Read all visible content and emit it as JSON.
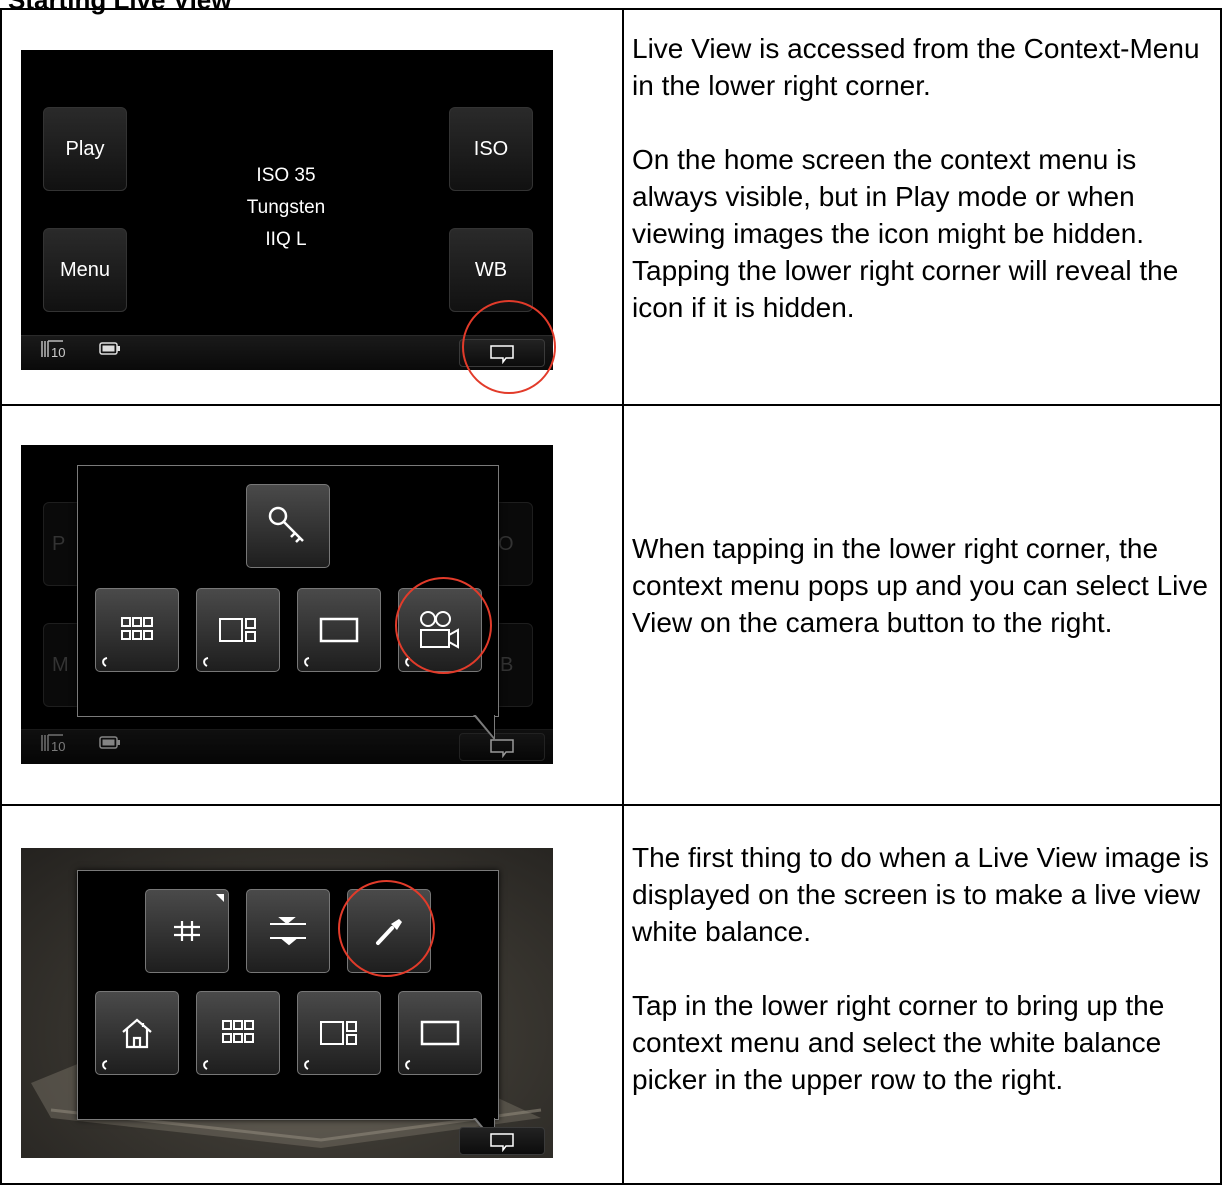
{
  "heading": "Starting Live View",
  "rows": [
    {
      "screen": {
        "buttons": {
          "play": "Play",
          "menu": "Menu",
          "iso": "ISO",
          "wb": "WB"
        },
        "info": [
          "ISO 35",
          "Tungsten",
          "IIQ L"
        ],
        "stack_count": "10"
      },
      "text": [
        "Live View is accessed from the Context-Menu in the lower right corner.",
        "On the home screen the context menu is always visible, but in Play mode or when viewing images the icon might be hidden. Tapping the lower right corner will reveal the icon if it is hidden."
      ]
    },
    {
      "screen": {
        "ghost_left_top": "P",
        "ghost_left_bottom": "M",
        "ghost_right_top": "O",
        "ghost_right_bottom": "B",
        "stack_count": "10",
        "top_icon": "key-icon",
        "bottom_icons": [
          "grid-view-icon",
          "split-view-icon",
          "single-view-icon",
          "video-camera-icon"
        ]
      },
      "text": [
        "When tapping in the lower right corner, the context menu pops up and you can select Live View on the camera button to the right."
      ]
    },
    {
      "screen": {
        "top_icons": [
          "hash-grid-icon",
          "level-sliders-icon",
          "eyedropper-icon"
        ],
        "bottom_icons": [
          "home-icon",
          "grid-view-icon",
          "split-view-icon",
          "single-view-icon"
        ]
      },
      "text": [
        "The first thing to do when a Live View image is displayed on the screen is to make a live view white balance.",
        "Tap in the lower right corner to bring up the context menu and select the white balance picker in the upper row to the right."
      ]
    }
  ],
  "colors": {
    "highlight": "#e23b2a",
    "screen_bg": "#000000"
  }
}
